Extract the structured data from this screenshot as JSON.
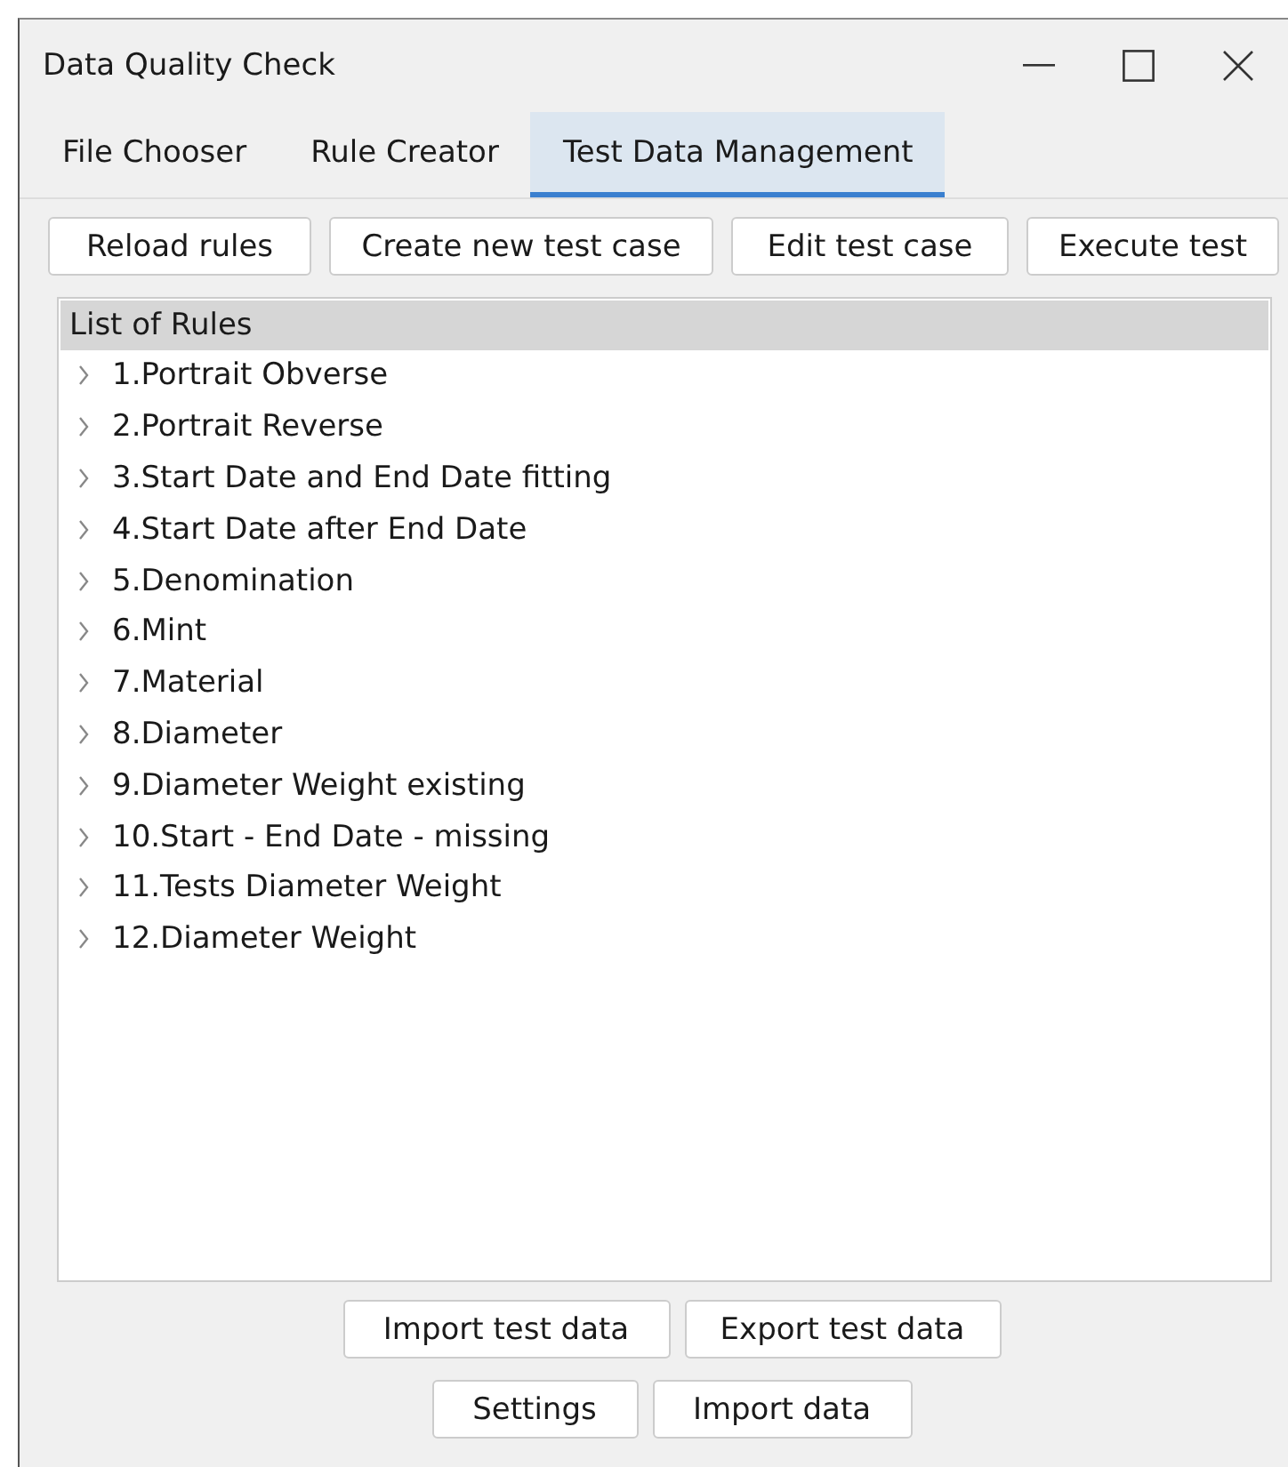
{
  "window": {
    "title": "Data Quality Check"
  },
  "tabs": [
    {
      "label": "File Chooser",
      "selected": false
    },
    {
      "label": "Rule Creator",
      "selected": false
    },
    {
      "label": "Test Data Management",
      "selected": true
    }
  ],
  "toolbar": [
    "Reload rules",
    "Create new test case",
    "Edit test case",
    "Execute test"
  ],
  "rules_list": {
    "header": "List of Rules",
    "items": [
      {
        "label": "1.Portrait Obverse",
        "expanded": false
      },
      {
        "label": "2.Portrait Reverse",
        "expanded": false
      },
      {
        "label": "3.Start Date and End Date fitting",
        "expanded": false
      },
      {
        "label": "4.Start Date after End Date",
        "expanded": false
      },
      {
        "label": "5.Denomination",
        "expanded": false
      },
      {
        "label": "6.Mint",
        "expanded": false
      },
      {
        "label": "7.Material",
        "expanded": false
      },
      {
        "label": "8.Diameter",
        "expanded": false
      },
      {
        "label": "9.Diameter Weight existing",
        "expanded": false
      },
      {
        "label": "10.Start - End Date - missing",
        "expanded": false
      },
      {
        "label": "11.Tests Diameter Weight",
        "expanded": false
      },
      {
        "label": "12.Diameter Weight",
        "expanded": false
      }
    ]
  },
  "bottom_buttons": [
    [
      "Import test data",
      "Export test data"
    ],
    [
      "Settings",
      "Import data"
    ]
  ]
}
